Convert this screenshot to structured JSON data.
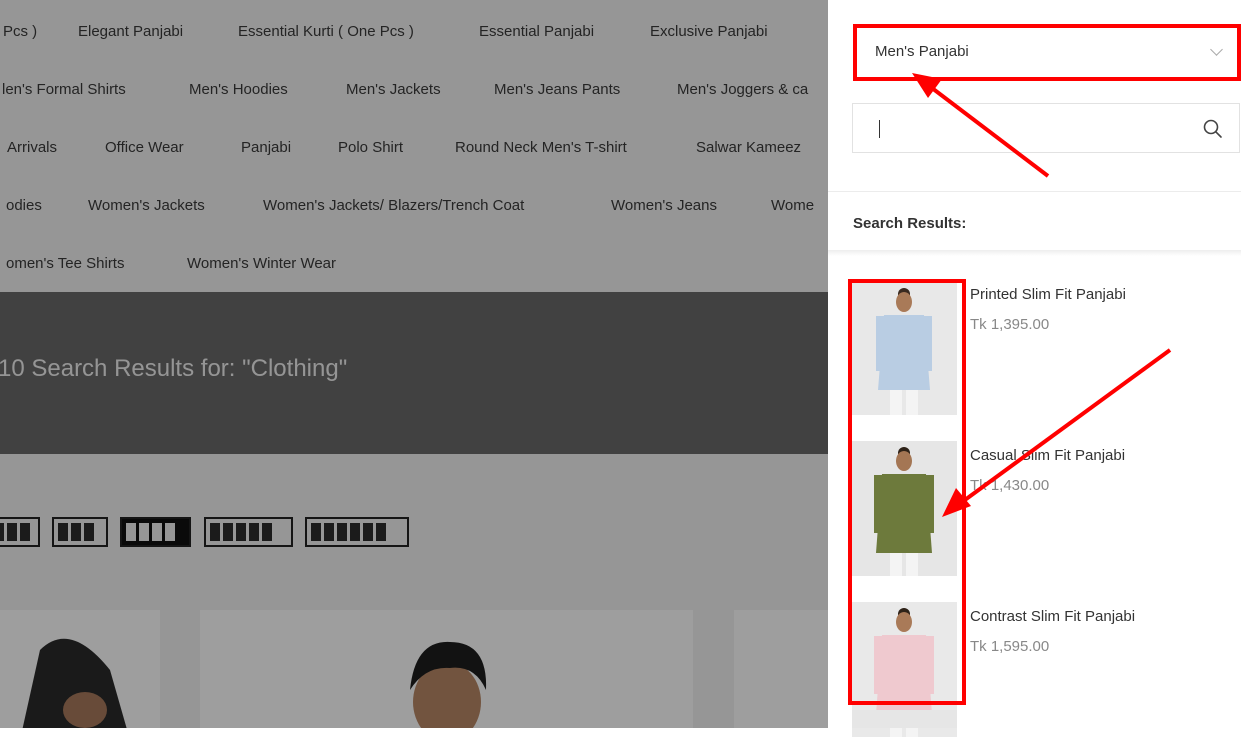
{
  "categories": {
    "row1": [
      "Pcs )",
      "Elegant Panjabi",
      "Essential Kurti ( One Pcs )",
      "Essential Panjabi",
      "Exclusive Panjabi"
    ],
    "row2": [
      "len's Formal Shirts",
      "Men's Hoodies",
      "Men's Jackets",
      "Men's Jeans Pants",
      "Men's Joggers & ca"
    ],
    "row3": [
      "Arrivals",
      "Office Wear",
      "Panjabi",
      "Polo Shirt",
      "Round Neck Men's T-shirt",
      "Salwar Kameez"
    ],
    "row4": [
      "odies",
      "Women's Jackets",
      "Women's Jackets/ Blazers/Trench Coat",
      "Women's Jeans",
      "Wome"
    ],
    "row5": [
      "omen's Tee Shirts",
      "Women's Winter Wear"
    ]
  },
  "banner": {
    "title": "10 Search Results for: \"Clothing\""
  },
  "search_panel": {
    "category_select": {
      "value": "Men's Panjabi",
      "icon": "chevron-down-icon"
    },
    "search": {
      "value": "",
      "placeholder": "",
      "icon": "search-icon"
    },
    "results_heading": "Search Results:",
    "results": [
      {
        "name": "Printed Slim Fit Panjabi",
        "price": "Tk 1,395.00",
        "kurta_color": "#b9cde3",
        "bg": "#e8e8e8"
      },
      {
        "name": "Casual Slim Fit Panjabi",
        "price": "Tk 1,430.00",
        "kurta_color": "#6d7a3c",
        "bg": "#e6e6e6"
      },
      {
        "name": "Contrast Slim Fit Panjabi",
        "price": "Tk 1,595.00",
        "kurta_color": "#efc9cf",
        "bg": "#e9e9e9"
      }
    ]
  },
  "colors": {
    "annotation_red": "#ff0000",
    "overlay": "rgba(0,0,0,0.38)",
    "banner": "#6a6a6a"
  }
}
